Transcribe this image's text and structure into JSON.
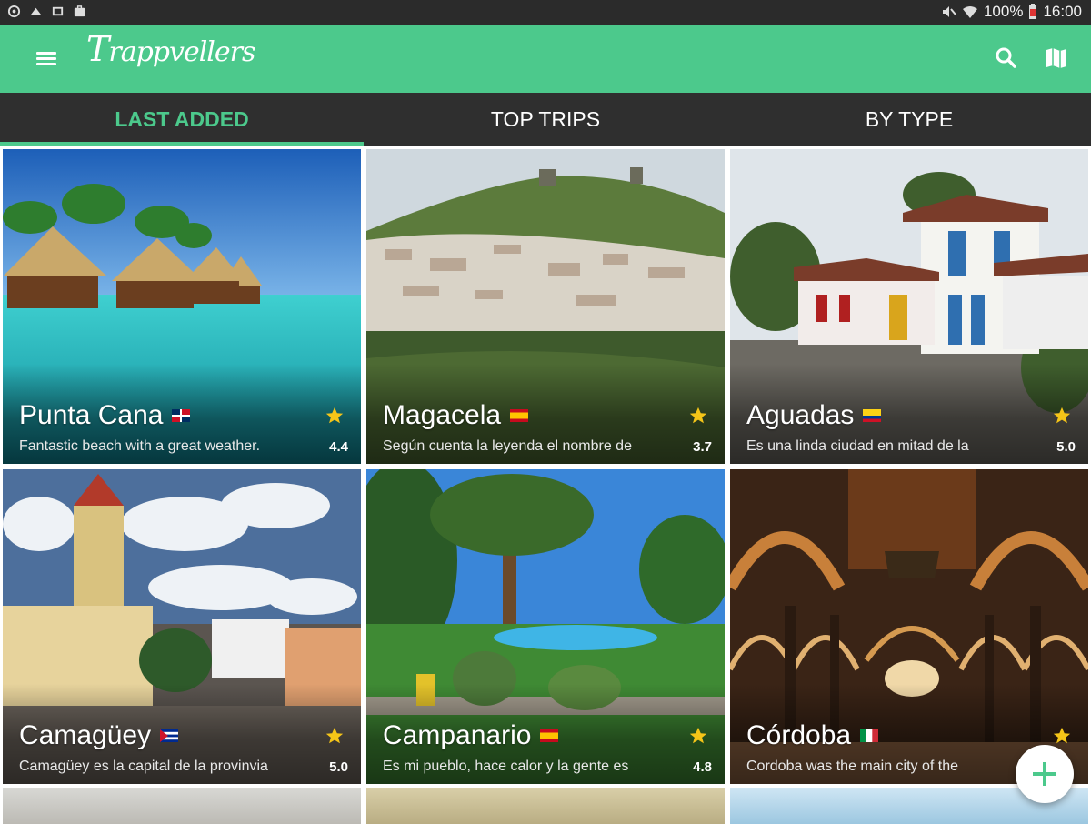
{
  "status_bar": {
    "left_icons": [
      "settings-notification-icon",
      "download-icon",
      "photo-icon",
      "briefcase-icon"
    ],
    "battery": "100%",
    "time": "16:00"
  },
  "app_bar": {
    "logo_first": "T",
    "logo_rest": "rappvellers",
    "color": "#4cc98c"
  },
  "tabs": [
    {
      "label": "LAST ADDED",
      "active": true
    },
    {
      "label": "TOP TRIPS",
      "active": false
    },
    {
      "label": "BY TYPE",
      "active": false
    }
  ],
  "places": [
    {
      "title": "Punta Cana",
      "flag": "dominican-republic",
      "desc": "Fantastic beach with a great weather.",
      "rating": "4.4"
    },
    {
      "title": "Magacela",
      "flag": "spain",
      "desc": "Según cuenta la leyenda el nombre de",
      "rating": "3.7"
    },
    {
      "title": "Aguadas",
      "flag": "colombia",
      "desc": "Es una linda ciudad en mitad de la",
      "rating": "5.0"
    },
    {
      "title": "Camagüey",
      "flag": "cuba",
      "desc": "Camagüey es la capital de la provinvia",
      "rating": "5.0"
    },
    {
      "title": "Campanario",
      "flag": "spain",
      "desc": "Es mi pueblo, hace calor y la gente es",
      "rating": "4.8"
    },
    {
      "title": "Córdoba",
      "flag": "italy",
      "desc": "Cordoba was the main city of the",
      "rating": ""
    }
  ],
  "colors": {
    "accent": "#4cc98c",
    "tab_bg": "#2f2f2f",
    "star": "#f5c518"
  }
}
